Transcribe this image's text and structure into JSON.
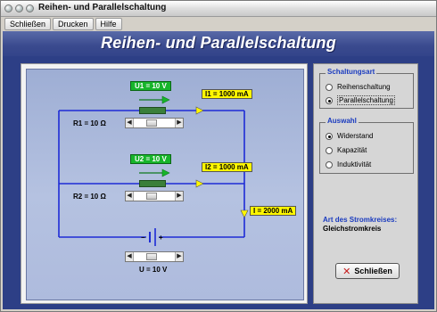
{
  "window": {
    "title": "Reihen- und Parallelschaltung"
  },
  "menu": [
    {
      "label": "Schließen"
    },
    {
      "label": "Drucken"
    },
    {
      "label": "Hilfe"
    }
  ],
  "header": {
    "title": "Reihen- und Parallelschaltung"
  },
  "circuit": {
    "u1": "U1 = 10 V",
    "u2": "U2 = 10 V",
    "i1": "I1 = 1000 mA",
    "i2": "I2 = 1000 mA",
    "i_total": "I = 2000 mA",
    "r1": "R1 = 10  Ω",
    "r2": "R2 = 10  Ω",
    "u": "U = 10 V",
    "battery_minus": "−",
    "battery_plus": "+",
    "slider_r1_level": 0.4,
    "slider_r2_level": 0.4,
    "slider_u_level": 0.4
  },
  "panel": {
    "schaltungsart": {
      "title": "Schaltungsart",
      "options": [
        "Reihenschaltung",
        "Parallelschaltung"
      ],
      "selected": "Parallelschaltung"
    },
    "auswahl": {
      "title": "Auswahl",
      "options": [
        "Widerstand",
        "Kapazität",
        "Induktivität"
      ],
      "selected": "Widerstand"
    },
    "art_title": "Art des Stromkreises:",
    "art_value": "Gleichstromkreis",
    "close_label": "Schließen",
    "close_icon": "x-icon"
  },
  "colors": {
    "background": "#2d3f86",
    "green_label": "#17b52b",
    "yellow_label": "#fff700",
    "wire": "#1d2bd6"
  }
}
